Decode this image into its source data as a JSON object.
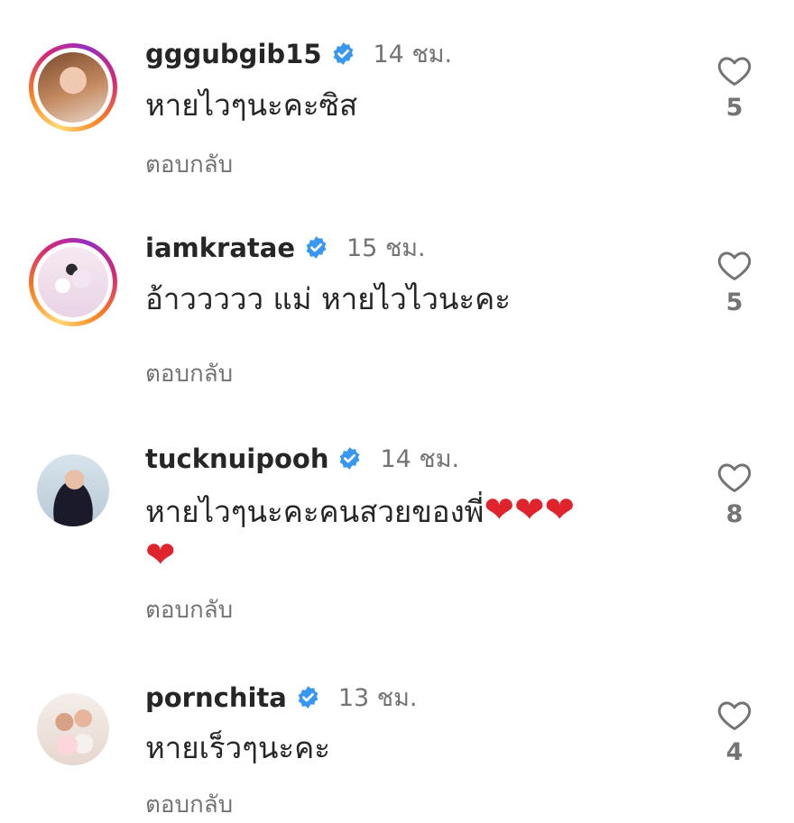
{
  "comments": [
    {
      "username": "gggubgib15",
      "time": "14 ชม.",
      "text": "หายไวๆนะคะซิส",
      "reply": "ตอบกลับ",
      "likes": "5",
      "avatar_ring": true
    },
    {
      "username": "iamkratae",
      "time": "15 ชม.",
      "text": "อ้าววววว แม่ หายไวไวนะคะ",
      "reply": "ตอบกลับ",
      "likes": "5",
      "avatar_ring": true
    },
    {
      "username": "tucknuipooh",
      "time": "14 ชม.",
      "text": "หายไวๆนะคะคนสวยของพี่",
      "text_emoji": "❤❤❤",
      "text_emoji_line2": "❤",
      "reply": "ตอบกลับ",
      "likes": "8",
      "avatar_ring": false
    },
    {
      "username": "pornchita",
      "time": "13 ชม.",
      "text": "หายเร็วๆนะคะ",
      "reply": "ตอบกลับ",
      "likes": "4",
      "avatar_ring": false
    }
  ],
  "colors": {
    "verified": "#3897f0",
    "muted": "#737373",
    "text": "#262626",
    "heart_emoji": "#e0242d"
  },
  "icons": {
    "verified": "verified-badge-icon",
    "like": "heart-outline-icon"
  }
}
